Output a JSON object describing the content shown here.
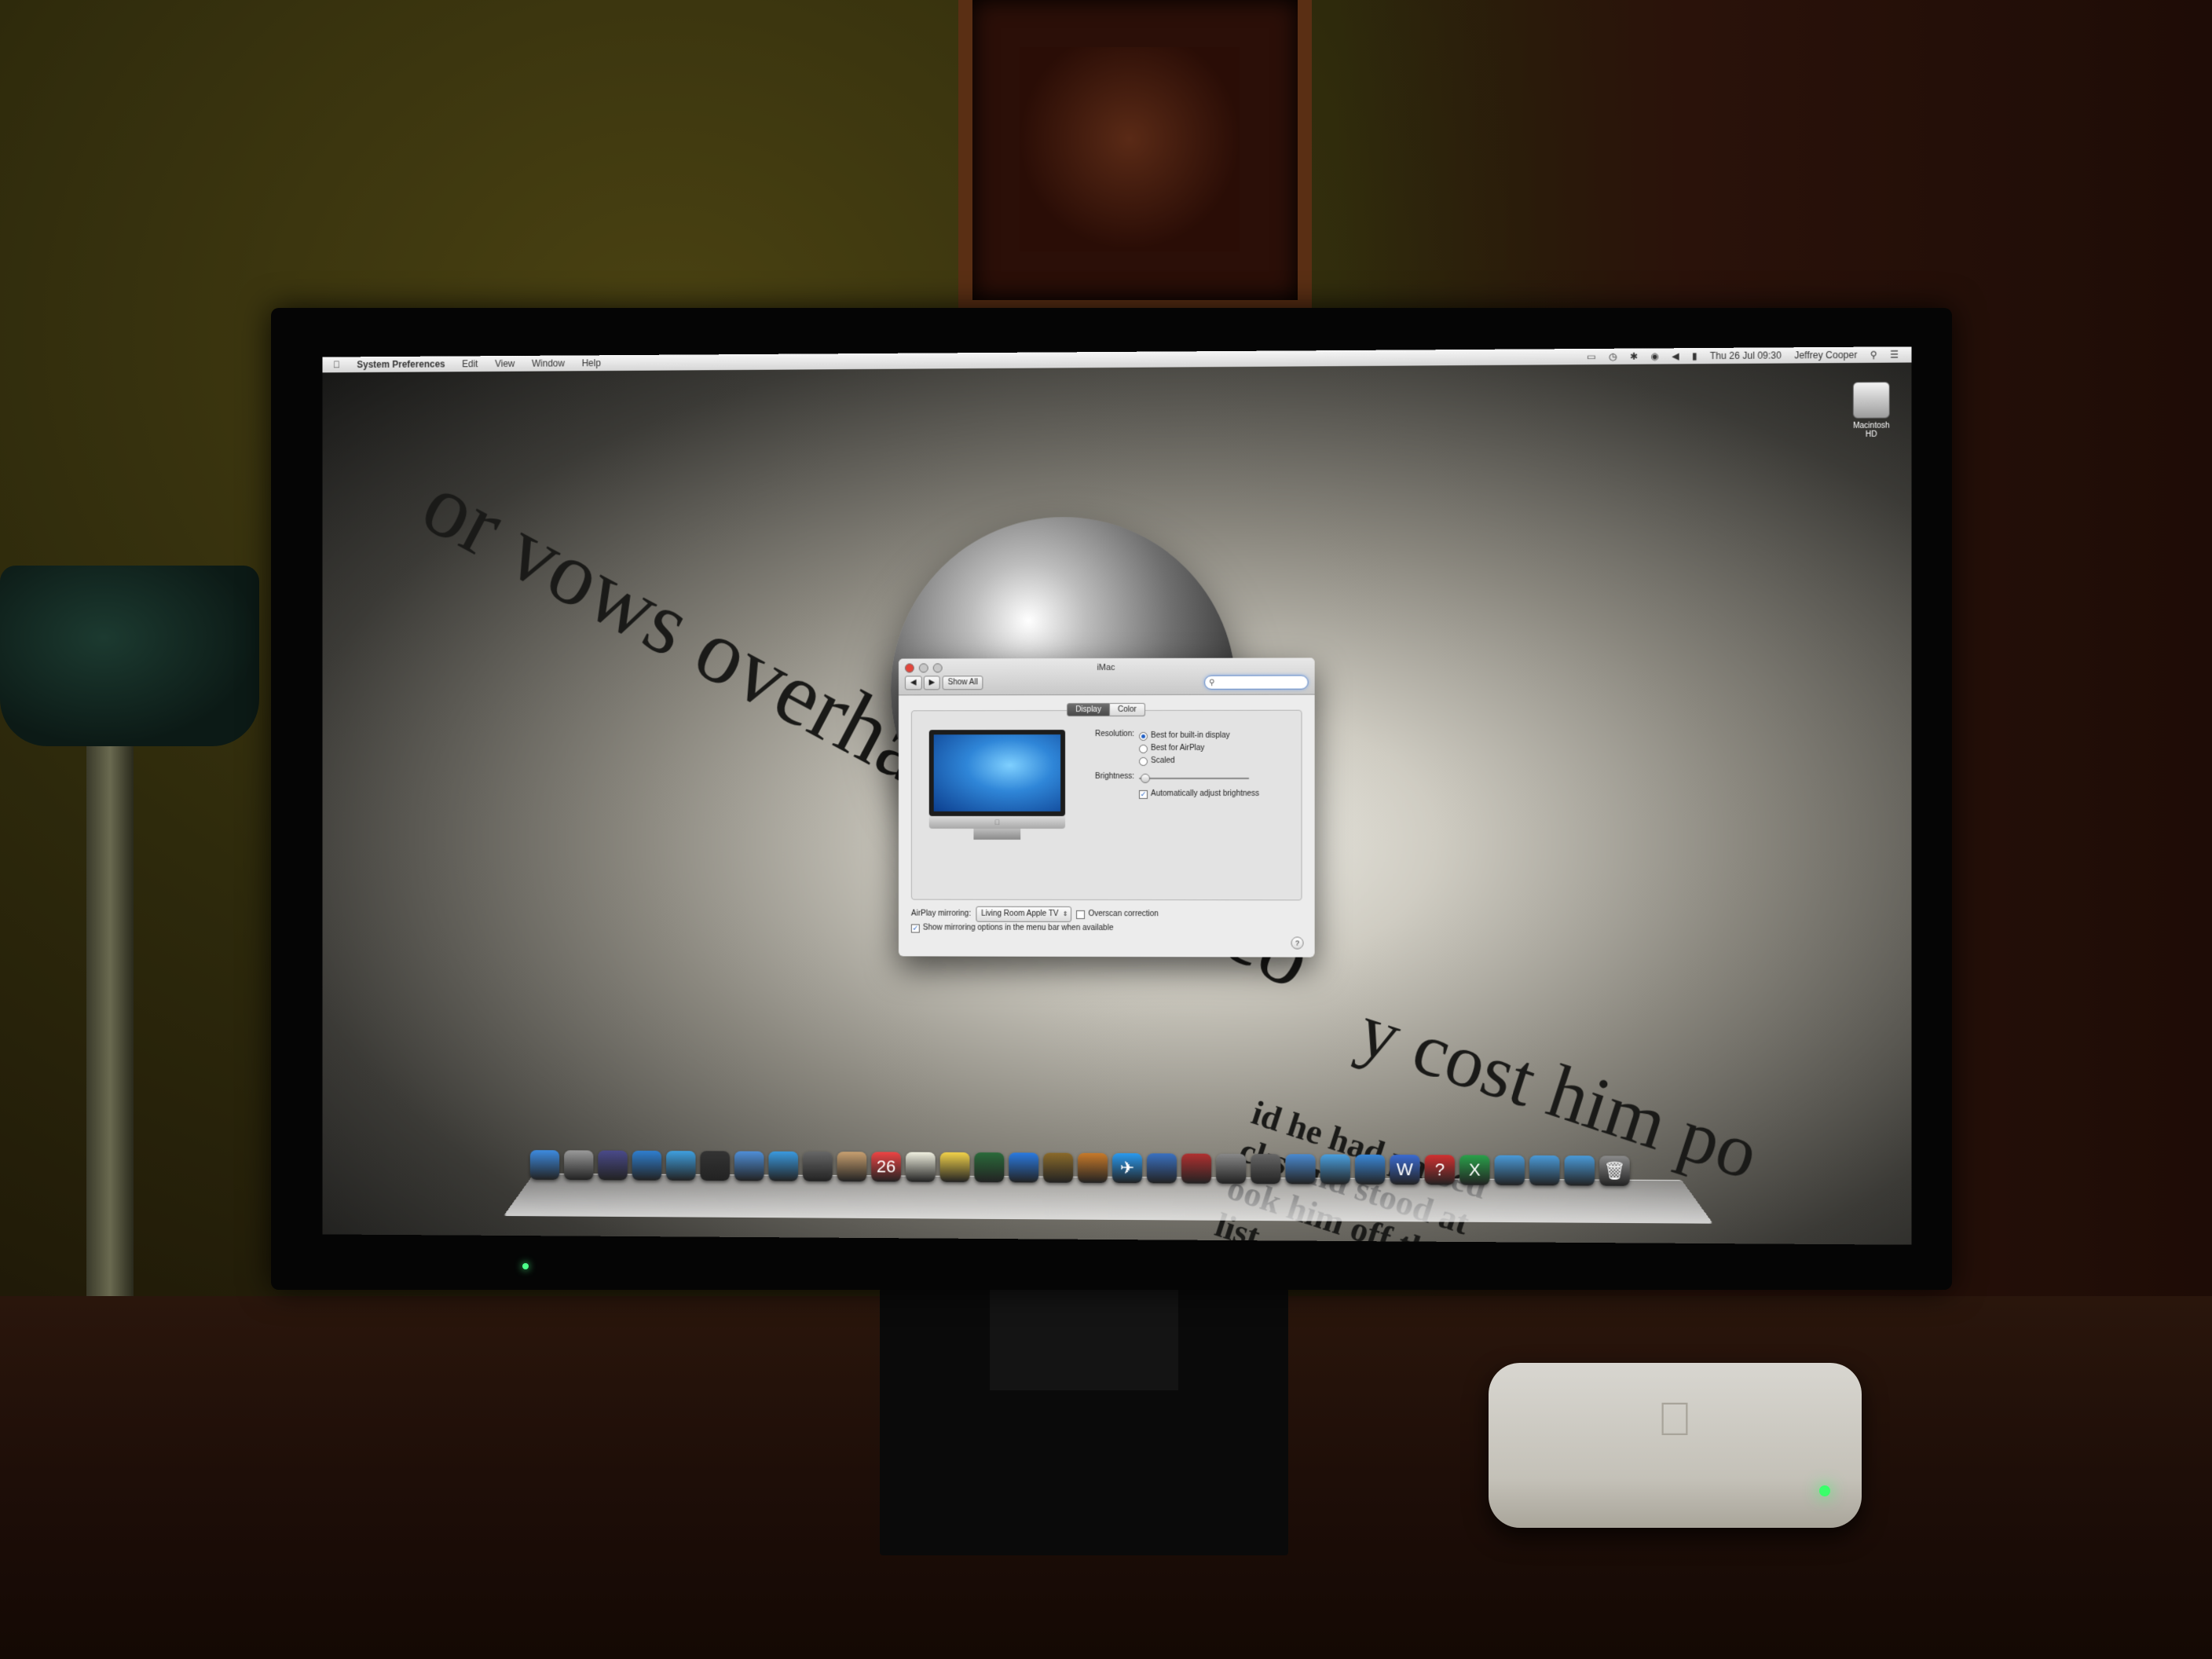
{
  "menubar": {
    "app": "System Preferences",
    "menus": [
      "Edit",
      "View",
      "Window",
      "Help"
    ],
    "clock": "Thu 26 Jul 09:30",
    "user": "Jeffrey Cooper"
  },
  "desktop": {
    "drive_label": "Macintosh HD",
    "headline_left": "or vows overhaul of city co",
    "headline_right": "y cost him po",
    "subhead": [
      "id he had passed",
      "cks and stood at",
      "ook him off the list when the",
      "list."
    ]
  },
  "window": {
    "title": "iMac",
    "show_all": "Show All",
    "search_placeholder": "",
    "tabs": [
      "Display",
      "Color"
    ],
    "resolution_label": "Resolution:",
    "resolution_options": [
      "Best for built-in display",
      "Best for AirPlay",
      "Scaled"
    ],
    "resolution_selected": 0,
    "brightness_label": "Brightness:",
    "brightness_level": 0.05,
    "auto_brightness_label": "Automatically adjust brightness",
    "auto_brightness_checked": true,
    "airplay_label": "AirPlay mirroring:",
    "airplay_value": "Living Room Apple TV",
    "overscan_label": "Overscan correction",
    "overscan_checked": false,
    "show_mirroring_label": "Show mirroring options in the menu bar when available",
    "show_mirroring_checked": true,
    "help": "?"
  },
  "dock": {
    "icons": [
      "finder-icon",
      "launchpad-icon",
      "mission-control-icon",
      "app-store-icon",
      "safari-icon",
      "dashboard-icon",
      "mail-icon",
      "messages-icon",
      "facetime-icon",
      "contacts-icon",
      "calendar-icon",
      "notes-icon",
      "stickies-icon",
      "time-machine-icon",
      "itunes-icon",
      "imovie-icon",
      "garageband-icon",
      "twitter-icon",
      "iphoto-icon",
      "photo-booth-icon",
      "system-preferences-icon",
      "utilities-icon",
      "preview-icon",
      "chat-icon",
      "app-icon-blue",
      "pages-icon",
      "text-app-icon",
      "excel-icon",
      "folder-applications-icon",
      "folder-documents-icon",
      "folder-downloads-icon",
      "trash-icon"
    ],
    "calendar_day": "26"
  },
  "colors": {
    "accent": "#1f5ec4",
    "led": "#3aff6a"
  }
}
